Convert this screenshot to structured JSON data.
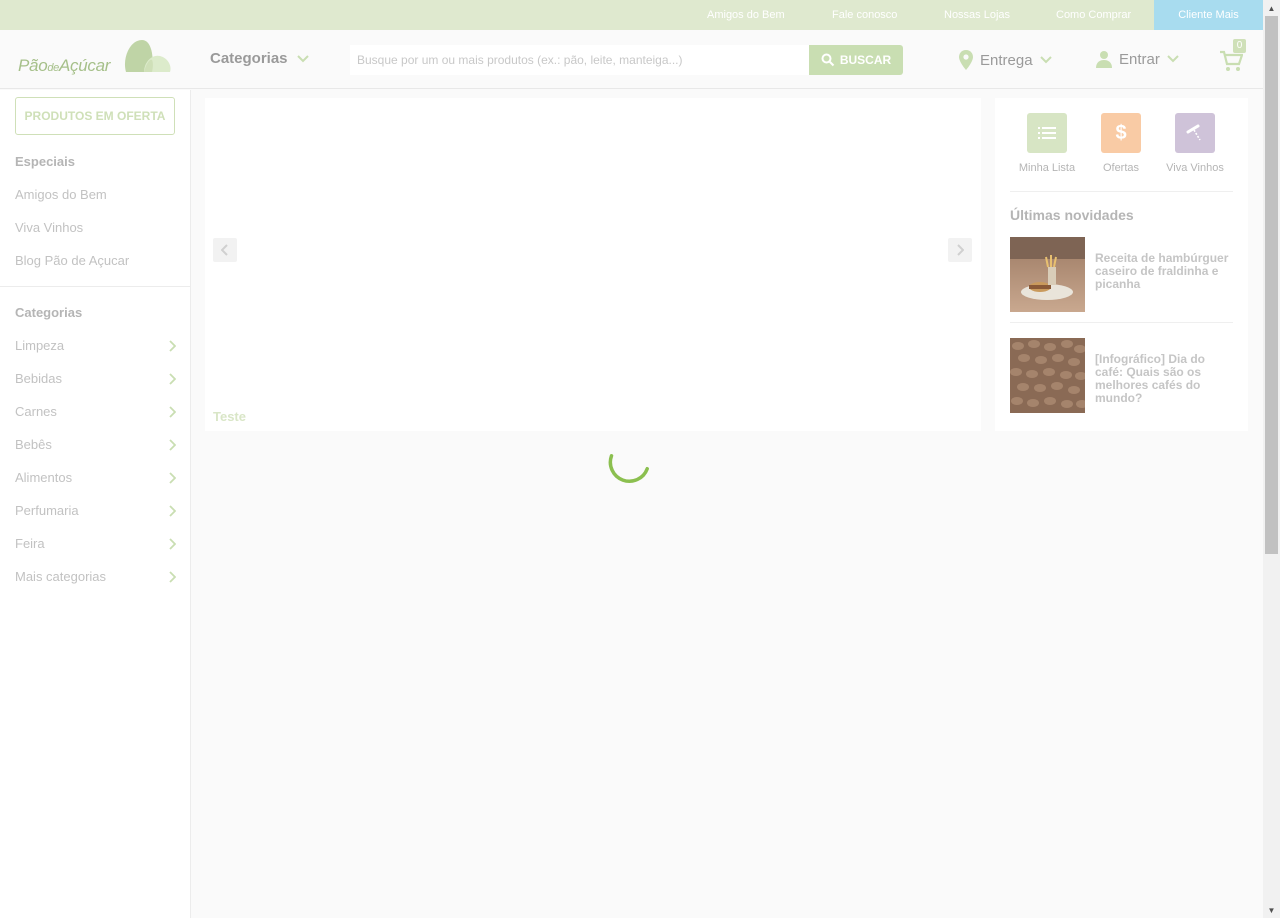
{
  "topbar": {
    "links": [
      "Amigos do Bem",
      "Fale conosco",
      "Nossas Lojas",
      "Como Comprar"
    ],
    "cliente_mais": "Cliente Mais"
  },
  "header": {
    "logo_text_1": "Pão",
    "logo_text_2": "de",
    "logo_text_3": "Açúcar",
    "categories_label": "Categorias",
    "search_placeholder": "Busque por um ou mais produtos (ex.: pão, leite, manteiga...)",
    "search_button": "BUSCAR",
    "delivery_label": "Entrega",
    "login_label": "Entrar",
    "cart_count": "0"
  },
  "sidebar": {
    "offer_button": "PRODUTOS EM OFERTA",
    "specials_heading": "Especiais",
    "specials": [
      "Amigos do Bem",
      "Viva Vinhos",
      "Blog Pão de Açucar"
    ],
    "categories_heading": "Categorias",
    "categories": [
      "Limpeza",
      "Bebidas",
      "Carnes",
      "Bebês",
      "Alimentos",
      "Perfumaria",
      "Feira",
      "Mais categorias"
    ]
  },
  "banner": {
    "caption": "Teste"
  },
  "right_panel": {
    "shortcuts": [
      {
        "label": "Minha Lista",
        "icon": "list-icon",
        "color": "#d7e5c4"
      },
      {
        "label": "Ofertas",
        "icon": "dollar-icon",
        "color": "#f9cba5"
      },
      {
        "label": "Viva Vinhos",
        "icon": "corkscrew-icon",
        "color": "#cfc3d9"
      }
    ],
    "news_heading": "Últimas novidades",
    "news": [
      {
        "title": "Receita de hambúrguer caseiro de fraldinha e picanha"
      },
      {
        "title": "[Infográfico] Dia do café: Quais são os melhores cafés do mundo?"
      }
    ]
  },
  "colors": {
    "brand_green": "#8bbf4f",
    "topbar_bg": "#dfe9cf",
    "cliente_mais_bg": "#a8dcef"
  }
}
